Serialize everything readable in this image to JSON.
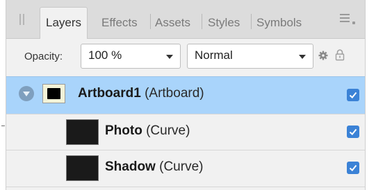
{
  "tabs": [
    {
      "label": "Layers",
      "active": true
    },
    {
      "label": "Effects",
      "active": false
    },
    {
      "label": "Assets",
      "active": false
    },
    {
      "label": "Styles",
      "active": false
    },
    {
      "label": "Symbols",
      "active": false
    }
  ],
  "toolbar": {
    "opacity_label": "Opacity:",
    "opacity_value": "100 %",
    "blend_mode": "Normal"
  },
  "layers": [
    {
      "name": "Artboard1",
      "kind": "(Artboard)",
      "selected": true,
      "expanded": true,
      "visible": true
    },
    {
      "name": "Photo",
      "kind": "(Curve)",
      "selected": false,
      "visible": true
    },
    {
      "name": "Shadow",
      "kind": "(Curve)",
      "selected": false,
      "visible": true
    }
  ],
  "colors": {
    "selection": "#a9d4fb",
    "checkbox": "#3b82d6",
    "panel": "#f1f1f1",
    "tabbar": "#dcdcdc"
  },
  "icons": {
    "grip": "grip-handle-icon",
    "panel_menu": "panel-menu-icon",
    "gear": "gear-icon",
    "lock": "lock-icon",
    "expander": "expand-triangle-icon",
    "visibility": "checkbox-checked-icon"
  }
}
